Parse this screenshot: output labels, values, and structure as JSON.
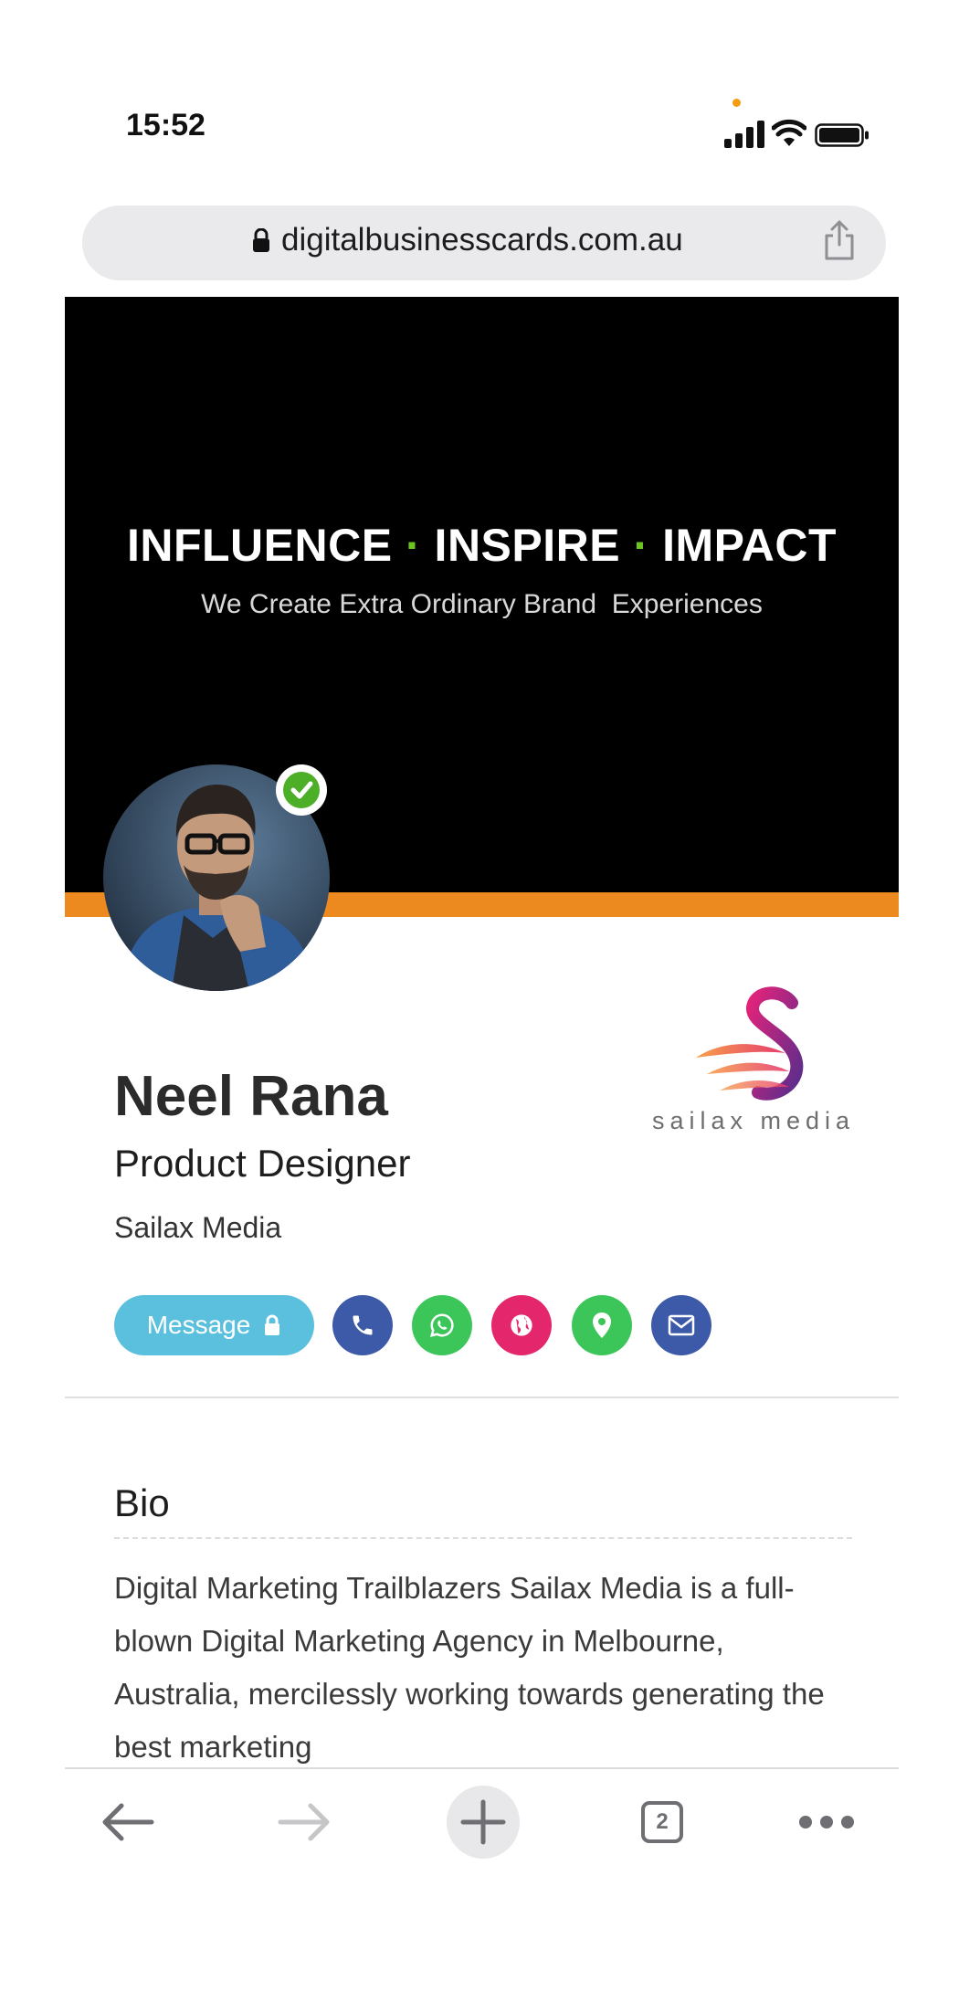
{
  "status_bar": {
    "time": "15:52",
    "icons": [
      "signal-icon",
      "wifi-icon",
      "battery-icon"
    ]
  },
  "url_bar": {
    "url": "digitalbusinesscards.com.au",
    "icons": [
      "lock-icon",
      "share-icon"
    ]
  },
  "banner": {
    "headline_words": [
      "INFLUENCE",
      "INSPIRE",
      "IMPACT"
    ],
    "tagline": "We Create Extra Ordinary Brand  Experiences",
    "accent_color": "#ed8a1f",
    "dot_color": "#6cc423"
  },
  "profile": {
    "name": "Neel Rana",
    "title": "Product Designer",
    "company": "Sailax Media",
    "verified": true
  },
  "company_logo": {
    "text": "sailax media"
  },
  "actions": {
    "message_label": "Message",
    "buttons": [
      {
        "name": "phone-button",
        "icon": "phone-icon",
        "color": "#3d5aa8"
      },
      {
        "name": "whatsapp-button",
        "icon": "whatsapp-icon",
        "color": "#3cc65a"
      },
      {
        "name": "website-button",
        "icon": "globe-icon",
        "color": "#e4266d"
      },
      {
        "name": "location-button",
        "icon": "map-pin-icon",
        "color": "#3cc65a"
      },
      {
        "name": "email-button",
        "icon": "envelope-icon",
        "color": "#3d5aa8"
      }
    ]
  },
  "bio": {
    "heading": "Bio",
    "text": "Digital Marketing Trailblazers Sailax Media is a full-blown Digital Marketing Agency in Melbourne, Australia, mercilessly working towards generating the best marketing"
  },
  "toolbar": {
    "tab_count": "2",
    "icons": [
      "back-arrow-icon",
      "forward-arrow-icon",
      "plus-icon",
      "tabs-icon",
      "more-icon"
    ]
  }
}
